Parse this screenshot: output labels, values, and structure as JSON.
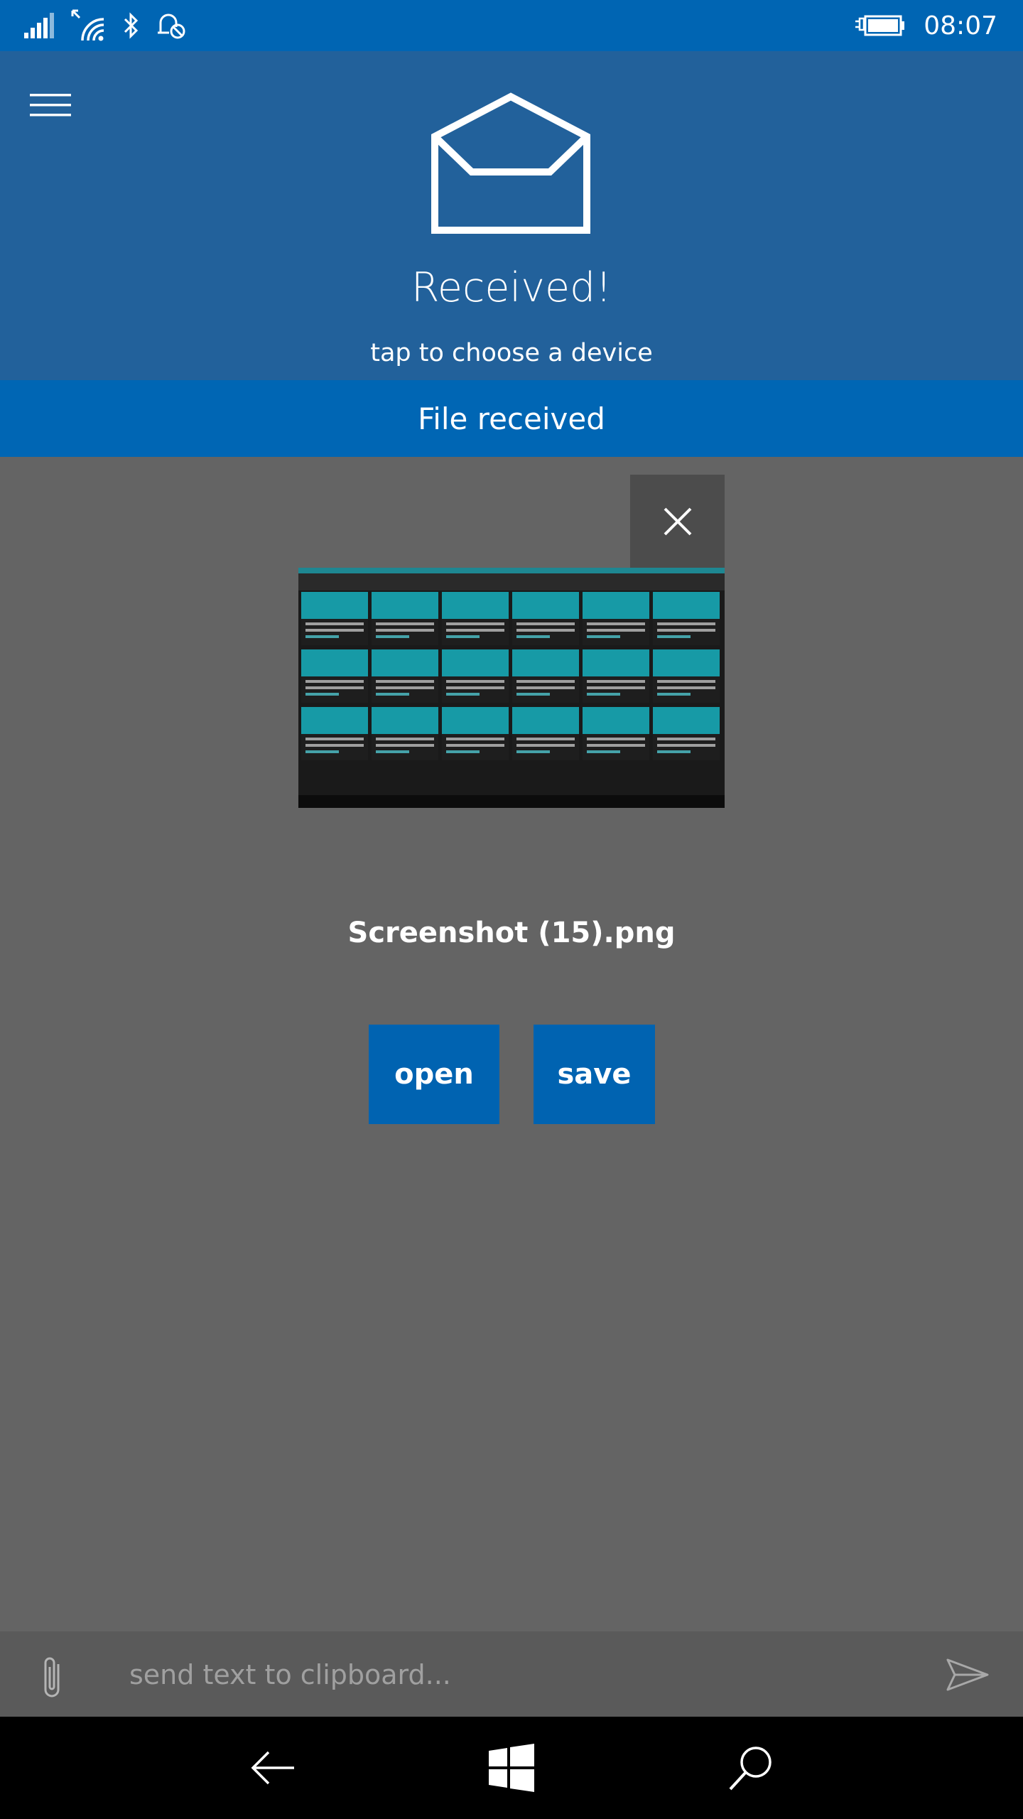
{
  "status_bar": {
    "time": "08:07",
    "icons": [
      "signal-icon",
      "wifi-icon",
      "bluetooth-icon",
      "quiet-hours-icon",
      "battery-charging-icon"
    ]
  },
  "header": {
    "menu_icon": "hamburger-icon",
    "status_icon": "envelope-open-icon",
    "title": "Received!",
    "subtitle": "tap to choose a device"
  },
  "banner": {
    "text": "File received"
  },
  "file": {
    "name": "Screenshot (15).png",
    "close_icon": "close-icon"
  },
  "actions": {
    "open_label": "open",
    "save_label": "save"
  },
  "clipboard": {
    "placeholder": "send text to clipboard...",
    "attach_icon": "paperclip-icon",
    "send_icon": "send-icon"
  },
  "nav": {
    "icons": [
      "back-icon",
      "windows-start-icon",
      "search-icon"
    ]
  },
  "colors": {
    "status_bar": "#0065b3",
    "header": "#22619b",
    "banner": "#0066b4",
    "background": "#646464",
    "button": "#0063b1"
  }
}
